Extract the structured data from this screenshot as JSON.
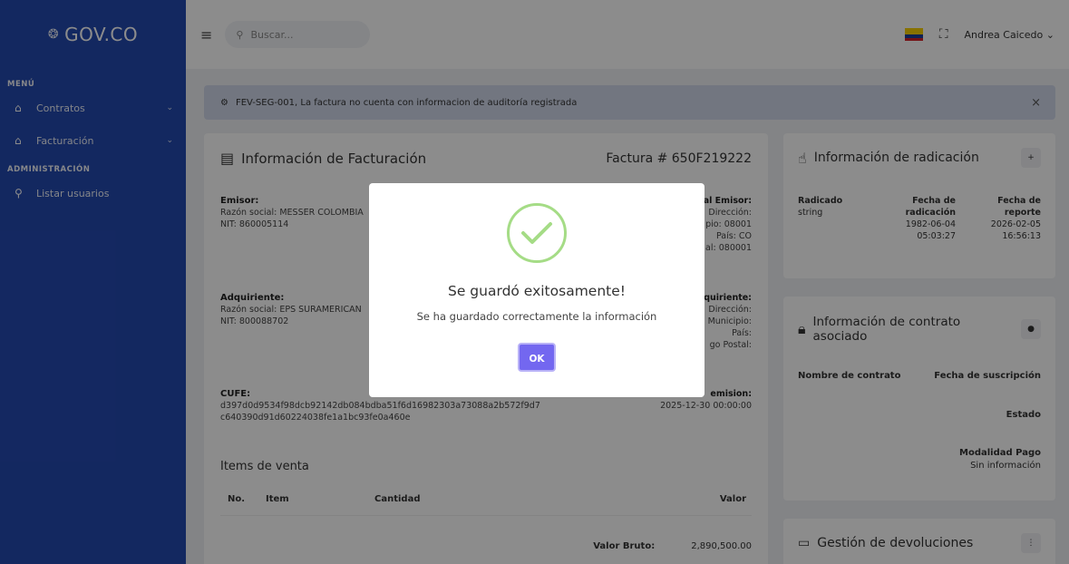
{
  "app": {
    "brand": "GOV.CO",
    "brand_mark": "❂",
    "user_name": "Andrea Caicedo"
  },
  "sidebar": {
    "sections": [
      {
        "title": "MENÚ",
        "items": [
          {
            "label": "Contratos"
          },
          {
            "label": "Facturación"
          }
        ]
      },
      {
        "title": "ADMINISTRACIÓN",
        "items": [
          {
            "label": "Listar usuarios"
          }
        ]
      }
    ]
  },
  "topbar": {
    "search_placeholder": "Buscar..."
  },
  "alert": {
    "text": "FEV-SEG-001, La factura no cuenta con informacion de auditoría registrada"
  },
  "billing": {
    "title": "Información de Facturación",
    "invoice_number": "Factura # 650F219222",
    "emisor": {
      "title": "Emisor:",
      "razon": "Razón social: MESSER COLOMBIA",
      "nit": "NIT: 860005114"
    },
    "emisor_right": {
      "title": "al Emisor:",
      "l1": "Dirección:",
      "l2": "pio: 08001",
      "l3": "País: CO",
      "l4": "al: 080001"
    },
    "adquiriente": {
      "title": "Adquiriente:",
      "razon": "Razón social: EPS SURAMERICAN",
      "nit": "NIT: 800088702"
    },
    "adq_right": {
      "title": "quiriente:",
      "l1": "Dirección:",
      "l2": "Municipio:",
      "l3": "País:",
      "l4": "go Postal:"
    },
    "cufe": {
      "title": "CUFE:",
      "l1": "d397d0d9534f98dcb92142db084bdba51f6d16982303a73088a2b572f9d7",
      "l2": "c640390d91d60224038fe1a1bc93fe0a460e"
    },
    "emision": {
      "title": "emision:",
      "value": "2025-12-30 00:00:00"
    },
    "items_title": "Items de venta",
    "columns": [
      "No.",
      "Item",
      "Cantidad",
      "Valor"
    ],
    "valor_bruto_label": "Valor Bruto:",
    "valor_bruto": "2,890,500.00"
  },
  "radicacion": {
    "title": "Información de radicación",
    "btn": "+",
    "col1_header": "Radicado",
    "col1_value": "string",
    "col2_header_l1": "Fecha de",
    "col2_header_l2": "radicación",
    "col2_v1": "1982-06-04",
    "col2_v2": "05:03:27",
    "col3_header_l1": "Fecha de",
    "col3_header_l2": "reporte",
    "col3_v1": "2026-02-05",
    "col3_v2": "16:56:13"
  },
  "contrato": {
    "title_l1": "Información de contrato",
    "title_l2": "asociado",
    "btn": "●",
    "nombre": "Nombre de contrato",
    "fecha": "Fecha de suscripción",
    "estado": "Estado",
    "modalidad": "Modalidad Pago",
    "modalidad_value": "Sin información"
  },
  "devoluciones": {
    "title": "Gestión de devoluciones",
    "btn": "⋮"
  },
  "modal": {
    "title": "Se guardó exitosamente!",
    "text": "Se ha guardado correctamente la información",
    "ok": "OK"
  },
  "colors": {
    "sidebar": "#2449b0",
    "accent": "#7367f0",
    "success": "#a5dc86",
    "alert_bg": "#cfd7ea"
  }
}
